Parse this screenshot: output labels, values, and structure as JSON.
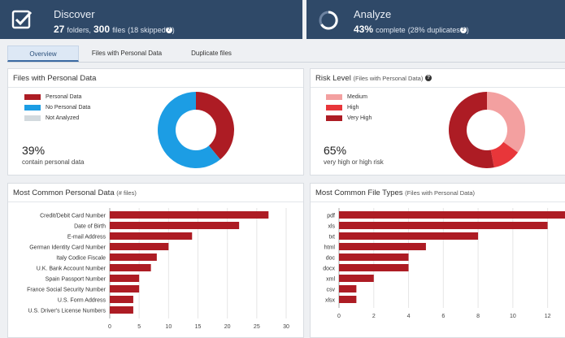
{
  "discover": {
    "title": "Discover",
    "folders": "27",
    "folders_label": "folders,",
    "files": "300",
    "files_label": "files",
    "skipped": "(18 skipped",
    "help": "?"
  },
  "analyze": {
    "title": "Analyze",
    "pct": "43%",
    "complete": "complete",
    "dups": "(28% duplicates",
    "help": "?"
  },
  "tabs": [
    {
      "label": "Overview",
      "active": true
    },
    {
      "label": "Files with Personal Data",
      "active": false
    },
    {
      "label": "Duplicate files",
      "active": false
    }
  ],
  "personal": {
    "title": "Files with Personal Data",
    "legend": [
      {
        "label": "Personal Data",
        "color": "#ad1c24"
      },
      {
        "label": "No Personal Data",
        "color": "#1c9de4"
      },
      {
        "label": "Not Analyzed",
        "color": "#d3dade"
      }
    ],
    "pct": "39%",
    "caption": "contain personal data"
  },
  "risk": {
    "title": "Risk Level",
    "title_paren": "(Files with Personal Data)",
    "help": "?",
    "legend": [
      {
        "label": "Medium",
        "color": "#f3a0a0"
      },
      {
        "label": "High",
        "color": "#e8363a"
      },
      {
        "label": "Very High",
        "color": "#ad1c24"
      }
    ],
    "pct": "65%",
    "caption": "very high or high risk"
  },
  "common_pd": {
    "title": "Most Common Personal Data",
    "title_paren": "(# files)"
  },
  "common_ft": {
    "title": "Most Common File Types",
    "title_paren": "(Files with Personal Data)"
  },
  "chart_data": [
    {
      "type": "pie",
      "title": "Files with Personal Data",
      "categories": [
        "Personal Data",
        "No Personal Data",
        "Not Analyzed"
      ],
      "values": [
        39,
        61,
        0
      ],
      "colors": [
        "#ad1c24",
        "#1c9de4",
        "#d3dade"
      ],
      "donut": true
    },
    {
      "type": "pie",
      "title": "Risk Level",
      "categories": [
        "Medium",
        "High",
        "Very High"
      ],
      "values": [
        35,
        12,
        53
      ],
      "colors": [
        "#f3a0a0",
        "#e8363a",
        "#ad1c24"
      ],
      "donut": true
    },
    {
      "type": "bar",
      "orientation": "horizontal",
      "title": "Most Common Personal Data",
      "categories": [
        "Credit/Debit Card Number",
        "Date of Birth",
        "E-mail Address",
        "German Identity Card Number",
        "Italy Codice Fiscale",
        "U.K. Bank Account Number",
        "Spain Passport Number",
        "France Social Security Number",
        "U.S. Form Address",
        "U.S. Driver's License Numbers"
      ],
      "values": [
        27,
        22,
        14,
        10,
        8,
        7,
        5,
        5,
        4,
        4
      ],
      "xlim": [
        0,
        30
      ],
      "ticks": [
        0,
        5,
        10,
        15,
        20,
        25,
        30
      ],
      "color": "#ad1c24",
      "grid": true
    },
    {
      "type": "bar",
      "orientation": "horizontal",
      "title": "Most Common File Types",
      "categories": [
        "pdf",
        "xls",
        "txt",
        "html",
        "doc",
        "docx",
        "xml",
        "csv",
        "xlsx"
      ],
      "values": [
        13,
        12,
        8,
        5,
        4,
        4,
        2,
        1,
        1
      ],
      "xlim": [
        0,
        13
      ],
      "ticks": [
        0,
        2,
        4,
        6,
        8,
        10,
        12
      ],
      "color": "#ad1c24",
      "grid": true
    }
  ]
}
